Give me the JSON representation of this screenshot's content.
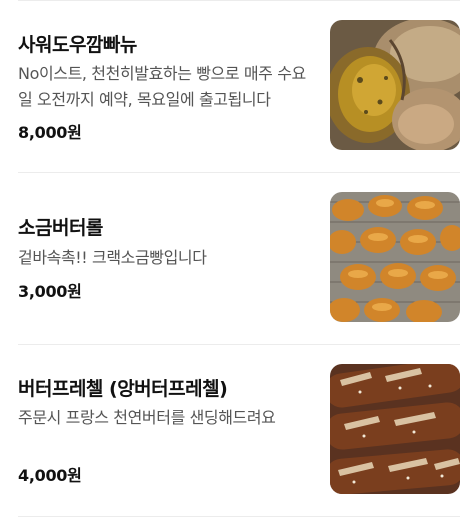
{
  "menu": {
    "items": [
      {
        "name": "사워도우깜빠뉴",
        "description": "No이스트, 천천히발효하는 빵으로 매주 수요일 오전까지 예약, 목요일에 출고됩니다",
        "price": "8,000원",
        "image": "sourdough-campagne-photo"
      },
      {
        "name": "소금버터롤",
        "description": "겉바속촉!! 크랙소금빵입니다",
        "price": "3,000원",
        "image": "salt-butter-roll-photo"
      },
      {
        "name": "버터프레첼 (앙버터프레첼)",
        "description": "주문시 프랑스 천연버터를 샌딩해드려요",
        "price": "4,000원",
        "image": "butter-pretzel-photo"
      }
    ]
  }
}
